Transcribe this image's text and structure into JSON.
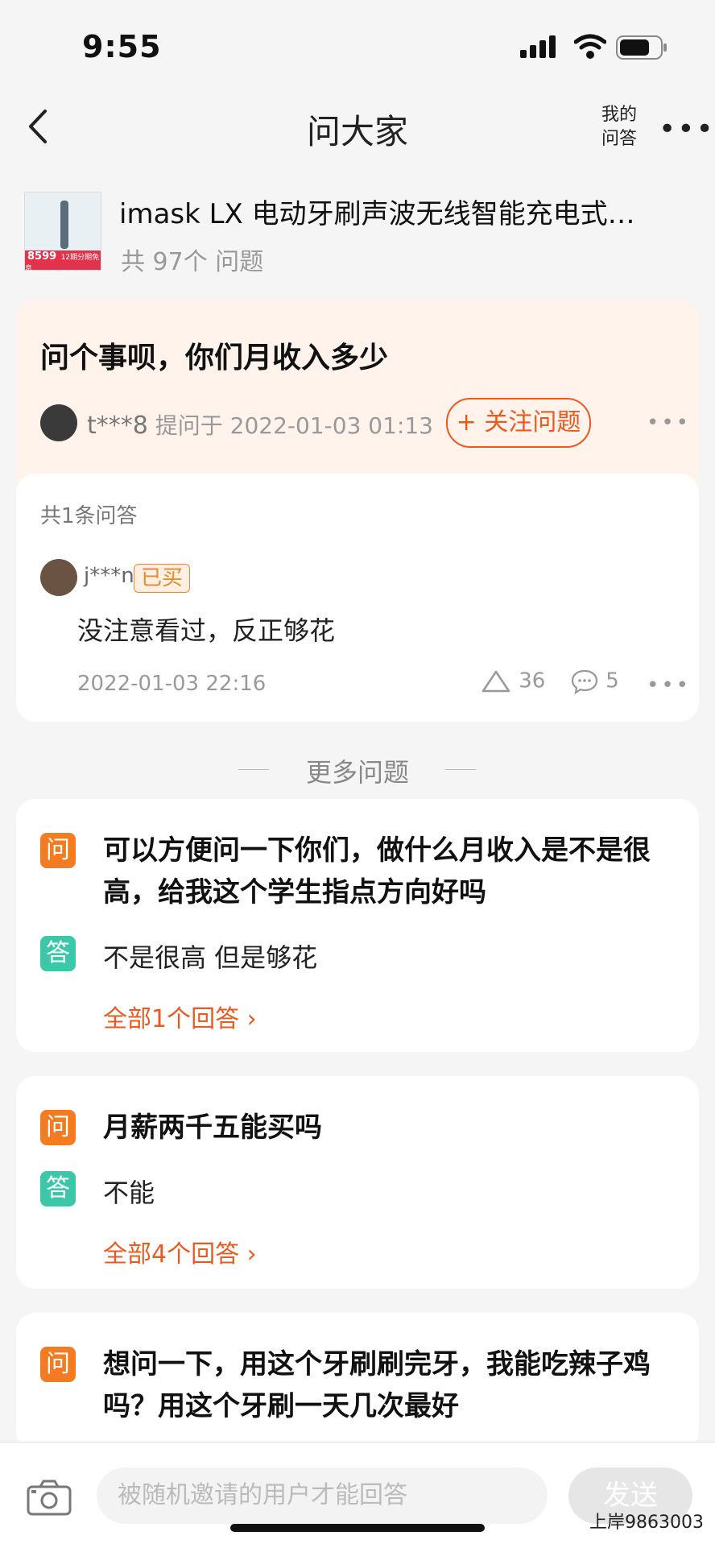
{
  "status_bar": {
    "time": "9:55"
  },
  "nav": {
    "title": "问大家",
    "my_qa_line1": "我的",
    "my_qa_line2": "问答",
    "more": "•••"
  },
  "product": {
    "title": "imask LX 电动牙刷声波无线智能充电式…",
    "count": "共 97个 问题",
    "thumb_price": "8599",
    "thumb_tag": "12期分期免息"
  },
  "question": {
    "title": "问个事呗，你们月收入多少",
    "asker_name": "t***8",
    "asked_at": "提问于 2022-01-03 01:13",
    "follow_label": "+ 关注问题"
  },
  "answers": {
    "count_label": "共1条问答",
    "user": "j***n",
    "bought_badge": "已买",
    "text": "没注意看过，反正够花",
    "date": "2022-01-03 22:16",
    "likes": "36",
    "comments": "5"
  },
  "more_section": {
    "label": "更多问题"
  },
  "more_questions": [
    {
      "q_badge": "问",
      "question": "可以方便问一下你们，做什么月收入是不是很高，给我这个学生指点方向好吗",
      "a_badge": "答",
      "answer": "不是很高 但是够花",
      "more": "全部1个回答"
    },
    {
      "q_badge": "问",
      "question": "月薪两千五能买吗",
      "a_badge": "答",
      "answer": "不能",
      "more": "全部4个回答"
    },
    {
      "q_badge": "问",
      "question": "想问一下，用这个牙刷刷完牙，我能吃辣子鸡吗？用这个牙刷一天几次最好"
    }
  ],
  "bottom_bar": {
    "input_placeholder": "被随机邀请的用户才能回答",
    "send_label": "发送",
    "watermark": "上岸9863003"
  },
  "colors": {
    "accent": "#e85a1e",
    "q_badge": "#f37b22",
    "a_badge": "#3cc8a8",
    "bought": "#e5892f"
  }
}
